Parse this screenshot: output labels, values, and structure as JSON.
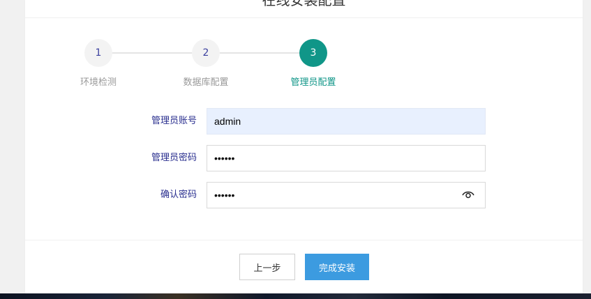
{
  "header": {
    "title": "在线安装配置"
  },
  "steps": [
    {
      "number": "1",
      "label": "环境检测"
    },
    {
      "number": "2",
      "label": "数据库配置"
    },
    {
      "number": "3",
      "label": "管理员配置"
    }
  ],
  "form": {
    "admin_account": {
      "label": "管理员账号",
      "value": "admin"
    },
    "admin_password": {
      "label": "管理员密码",
      "value": "••••••"
    },
    "confirm_password": {
      "label": "确认密码",
      "value": "••••••"
    }
  },
  "buttons": {
    "prev": "上一步",
    "finish": "完成安装"
  },
  "colors": {
    "accent": "#109688",
    "primary_button": "#3c9be0",
    "label": "#2a2f8f"
  }
}
